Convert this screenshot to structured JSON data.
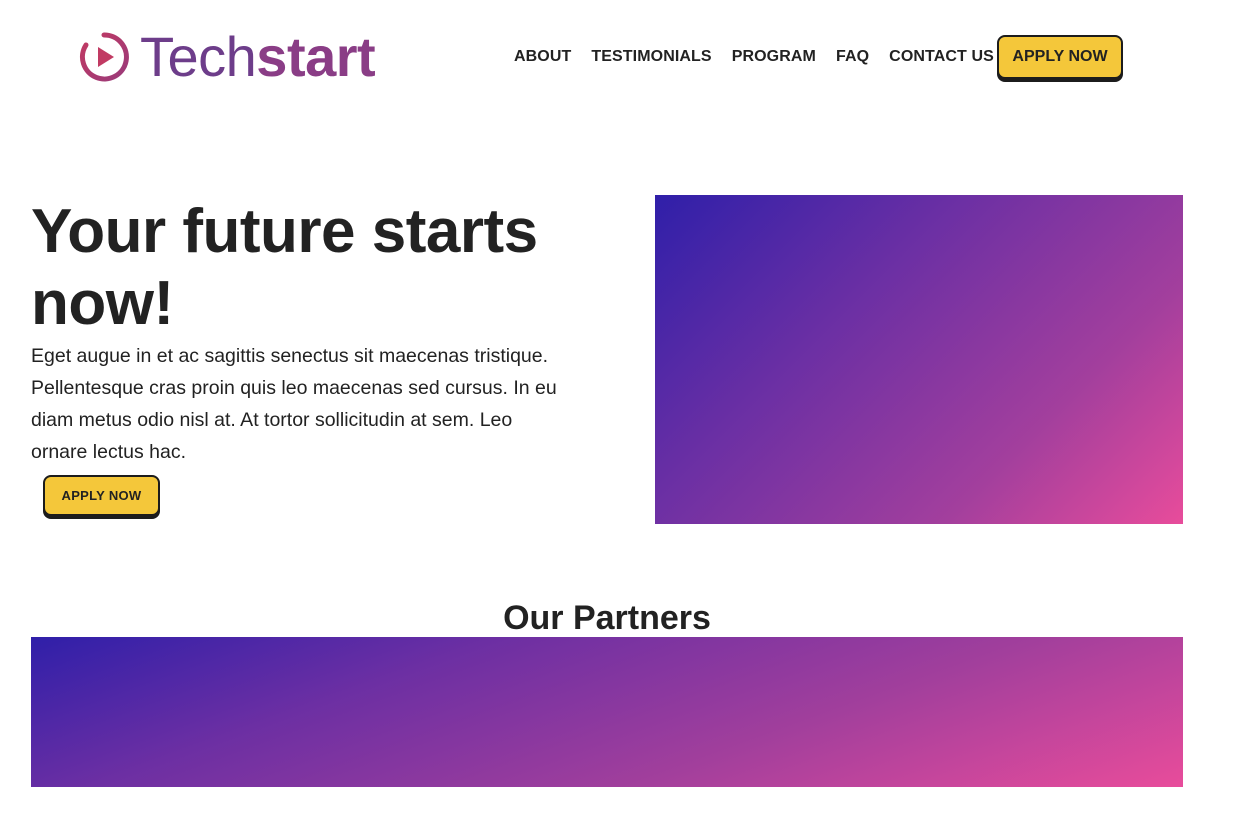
{
  "brand": {
    "name_part1": "Tech",
    "name_part2": "start",
    "icon": "play-circle-icon",
    "colors": {
      "primary": "#6d3d8a",
      "accent": "#8a3d86",
      "icon": "#c3405f"
    }
  },
  "nav": {
    "items": [
      {
        "label": "ABOUT"
      },
      {
        "label": "TESTIMONIALS"
      },
      {
        "label": "PROGRAM"
      },
      {
        "label": "FAQ"
      },
      {
        "label": "CONTACT US"
      }
    ],
    "cta_label": "APPLY NOW"
  },
  "hero": {
    "title": "Your future starts now!",
    "body": "Eget augue in et ac sagittis senectus sit maecenas tristique. Pellentesque cras proin quis leo maecenas sed cursus. In eu diam metus odio nisl at. At tortor sollicitudin at sem. Leo ornare lectus hac.",
    "cta_label": "APPLY NOW"
  },
  "partners": {
    "title": "Our Partners"
  },
  "colors": {
    "button_fill": "#f4c73a",
    "gradient_start": "#2f1fa9",
    "gradient_end": "#e84c9b",
    "text": "#222222"
  }
}
